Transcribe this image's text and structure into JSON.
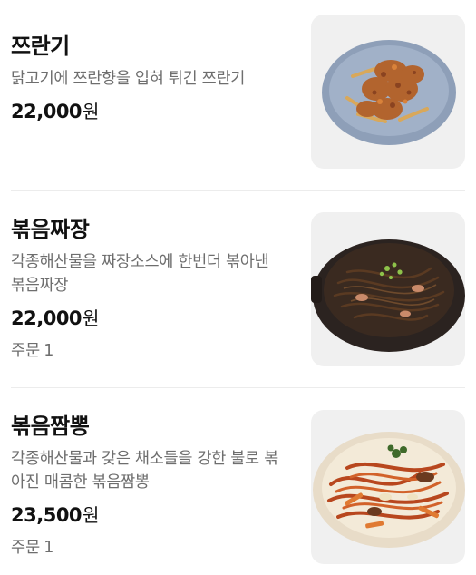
{
  "menu": {
    "items": [
      {
        "name": "쯔란기",
        "description": "닭고기에 쯔란향을 입혀 튀긴 쯔란기",
        "price": "22,000",
        "currency": "원",
        "image_icon": "fried-chicken-plate-photo"
      },
      {
        "name": "볶음짜장",
        "description": "각종해산물을 짜장소스에 한번더 볶아낸 볶음짜장",
        "price": "22,000",
        "currency": "원",
        "order_label": "주문",
        "order_count": "1",
        "image_icon": "jjajang-noodle-pot-photo"
      },
      {
        "name": "볶음짬뽕",
        "description": "각종해산물과 갖은 채소들을 강한 불로 볶아진 매콤한 볶음짬뽕",
        "price": "23,500",
        "currency": "원",
        "order_label": "주문",
        "order_count": "1",
        "image_icon": "jjamppong-noodle-plate-photo"
      }
    ]
  }
}
